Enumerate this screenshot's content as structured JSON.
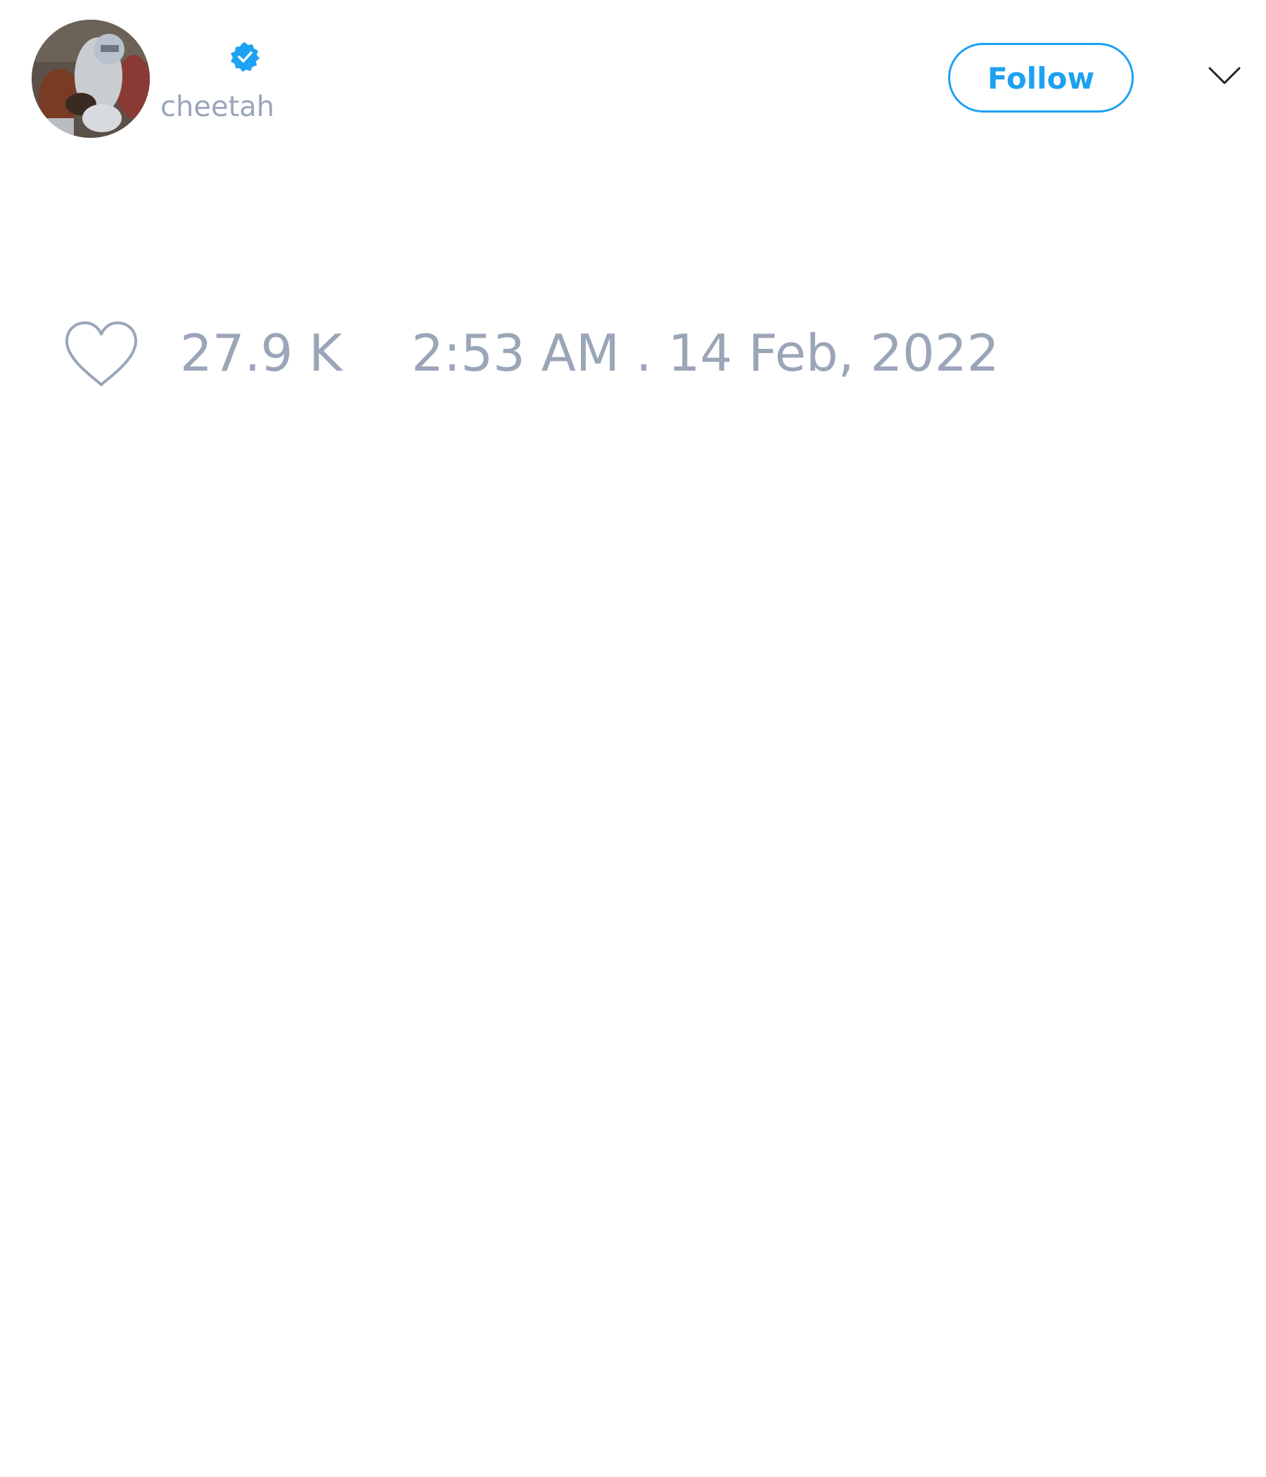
{
  "author": {
    "display_name": "",
    "handle": "cheetah",
    "verified": true,
    "avatar_icon": "avatar-photo-football-player"
  },
  "actions": {
    "follow_label": "Follow",
    "menu_icon": "chevron-down-icon"
  },
  "stats": {
    "like_icon": "heart-icon",
    "like_count": "27.9 K",
    "timestamp": "2:53 AM . 14 Feb, 2022"
  },
  "colors": {
    "accent": "#1da1f2",
    "muted_text": "#9aa5b8",
    "background": "#ffffff"
  }
}
